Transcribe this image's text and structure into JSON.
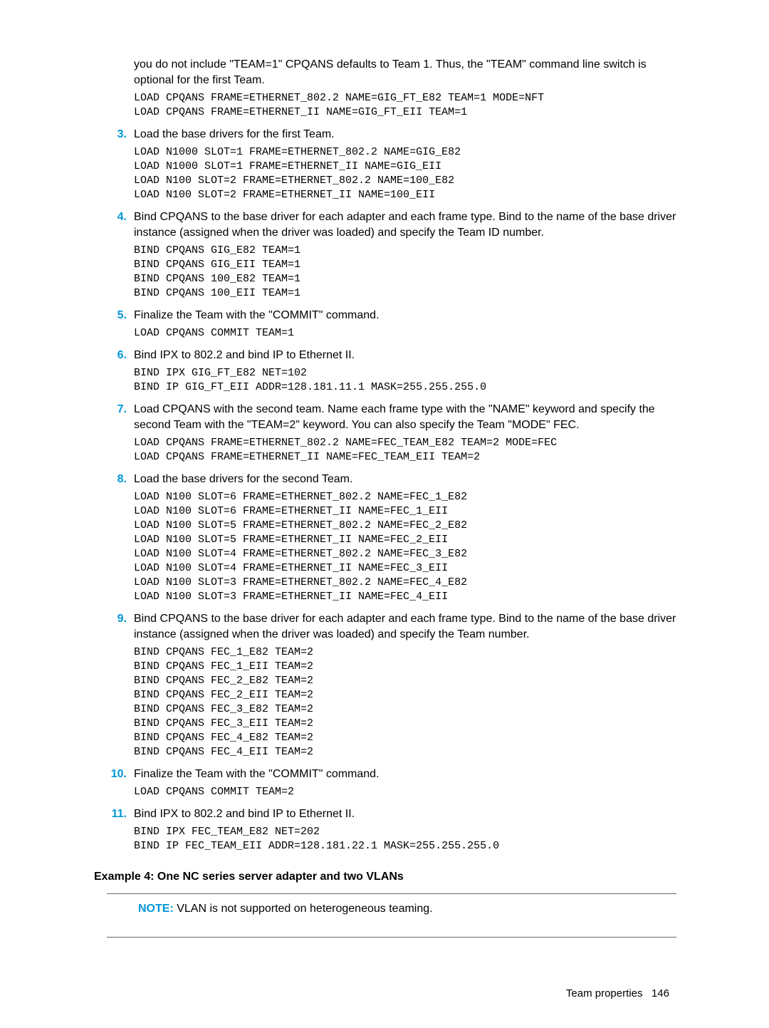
{
  "intro_text": "you do not include \"TEAM=1\" CPQANS defaults to Team 1. Thus, the \"TEAM\" command line switch is optional for the first Team.",
  "intro_code": "LOAD CPQANS FRAME=ETHERNET_802.2 NAME=GIG_FT_E82 TEAM=1 MODE=NFT\nLOAD CPQANS FRAME=ETHERNET_II NAME=GIG_FT_EII TEAM=1",
  "steps": [
    {
      "num": "3.",
      "text": "Load the base drivers for the first Team.",
      "code": "LOAD N1000 SLOT=1 FRAME=ETHERNET_802.2 NAME=GIG_E82\nLOAD N1000 SLOT=1 FRAME=ETHERNET_II NAME=GIG_EII\nLOAD N100 SLOT=2 FRAME=ETHERNET_802.2 NAME=100_E82\nLOAD N100 SLOT=2 FRAME=ETHERNET_II NAME=100_EII"
    },
    {
      "num": "4.",
      "text": "Bind CPQANS to the base driver for each adapter and each frame type. Bind to the name of the base driver instance (assigned when the driver was loaded) and specify the Team ID number.",
      "code": "BIND CPQANS GIG_E82 TEAM=1\nBIND CPQANS GIG_EII TEAM=1\nBIND CPQANS 100_E82 TEAM=1\nBIND CPQANS 100_EII TEAM=1"
    },
    {
      "num": "5.",
      "text": "Finalize the Team with the \"COMMIT\" command.",
      "code": "LOAD CPQANS COMMIT TEAM=1"
    },
    {
      "num": "6.",
      "text": "Bind IPX to 802.2 and bind IP to Ethernet II.",
      "code": "BIND IPX GIG_FT_E82 NET=102\nBIND IP GIG_FT_EII ADDR=128.181.11.1 MASK=255.255.255.0"
    },
    {
      "num": "7.",
      "text": "Load CPQANS with the second team. Name each frame type with the \"NAME\" keyword and specify the second Team with the \"TEAM=2\" keyword. You can also specify the Team \"MODE\" FEC.",
      "code": "LOAD CPQANS FRAME=ETHERNET_802.2 NAME=FEC_TEAM_E82 TEAM=2 MODE=FEC\nLOAD CPQANS FRAME=ETHERNET_II NAME=FEC_TEAM_EII TEAM=2"
    },
    {
      "num": "8.",
      "text": "Load the base drivers for the second Team.",
      "code": "LOAD N100 SLOT=6 FRAME=ETHERNET_802.2 NAME=FEC_1_E82\nLOAD N100 SLOT=6 FRAME=ETHERNET_II NAME=FEC_1_EII\nLOAD N100 SLOT=5 FRAME=ETHERNET_802.2 NAME=FEC_2_E82\nLOAD N100 SLOT=5 FRAME=ETHERNET_II NAME=FEC_2_EII\nLOAD N100 SLOT=4 FRAME=ETHERNET_802.2 NAME=FEC_3_E82\nLOAD N100 SLOT=4 FRAME=ETHERNET_II NAME=FEC_3_EII\nLOAD N100 SLOT=3 FRAME=ETHERNET_802.2 NAME=FEC_4_E82\nLOAD N100 SLOT=3 FRAME=ETHERNET_II NAME=FEC_4_EII"
    },
    {
      "num": "9.",
      "text": "Bind CPQANS to the base driver for each adapter and each frame type. Bind to the name of the base driver instance (assigned when the driver was loaded) and specify the Team number.",
      "code": "BIND CPQANS FEC_1_E82 TEAM=2\nBIND CPQANS FEC_1_EII TEAM=2\nBIND CPQANS FEC_2_E82 TEAM=2\nBIND CPQANS FEC_2_EII TEAM=2\nBIND CPQANS FEC_3_E82 TEAM=2\nBIND CPQANS FEC_3_EII TEAM=2\nBIND CPQANS FEC_4_E82 TEAM=2\nBIND CPQANS FEC_4_EII TEAM=2"
    },
    {
      "num": "10.",
      "text": "Finalize the Team with the \"COMMIT\" command.",
      "code": "LOAD CPQANS COMMIT TEAM=2"
    },
    {
      "num": "11.",
      "text": "Bind IPX to 802.2 and bind IP to Ethernet II.",
      "code": "BIND IPX FEC_TEAM_E82 NET=202\nBIND IP FEC_TEAM_EII ADDR=128.181.22.1 MASK=255.255.255.0"
    }
  ],
  "example_heading": "Example 4: One NC series server adapter and two VLANs",
  "note_label": "NOTE:",
  "note_text": "VLAN is not supported on heterogeneous teaming.",
  "footer_section": "Team properties",
  "footer_page": "146"
}
